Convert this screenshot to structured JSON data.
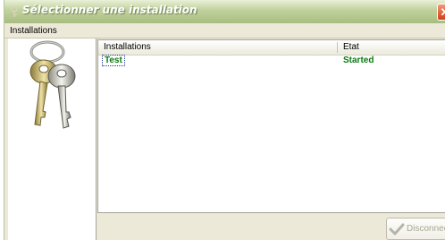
{
  "window": {
    "title": "Sélectionner une installation",
    "close_symbol": "✕",
    "title_icon": "key-icon"
  },
  "group": {
    "label": "Installations"
  },
  "list": {
    "columns": [
      "Installations",
      "Etat"
    ],
    "rows": [
      {
        "name": "Test",
        "status": "Started",
        "status_color": "#0b7a12"
      }
    ]
  },
  "buttons": {
    "disconnect_label": "Disconnect",
    "disconnect_icon": "check-icon"
  },
  "colors": {
    "title_bar": "#a8bd80",
    "status_started": "#0b7a12",
    "close_button": "#e05f3a"
  }
}
